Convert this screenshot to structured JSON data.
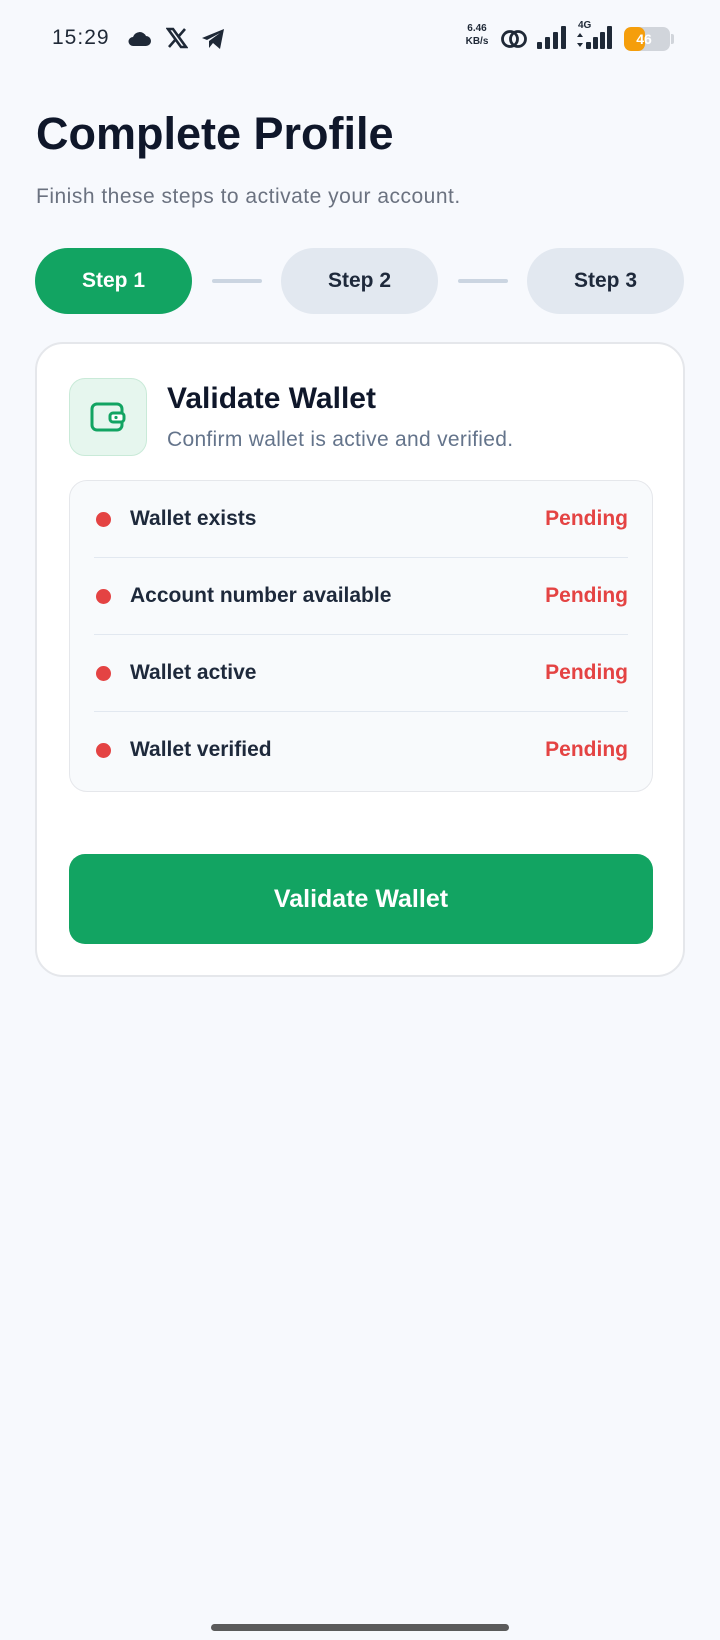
{
  "status_bar": {
    "time": "15:29",
    "net_speed_value": "6.46",
    "net_speed_unit": "KB/s",
    "network_type": "4G",
    "battery_level": "46",
    "icons": [
      "cloud-icon",
      "x-logo-icon",
      "telegram-icon",
      "hotspot-link-icon",
      "signal-icon",
      "signal-4g-icon",
      "battery-icon"
    ]
  },
  "header": {
    "title": "Complete Profile",
    "subtitle": "Finish these steps to activate your account."
  },
  "stepper": {
    "steps": [
      {
        "label": "Step 1",
        "active": true
      },
      {
        "label": "Step 2",
        "active": false
      },
      {
        "label": "Step 3",
        "active": false
      }
    ]
  },
  "card": {
    "icon": "wallet-icon",
    "title": "Validate Wallet",
    "subtitle": "Confirm wallet is active and verified.",
    "checks": [
      {
        "label": "Wallet exists",
        "status": "Pending"
      },
      {
        "label": "Account number available",
        "status": "Pending"
      },
      {
        "label": "Wallet active",
        "status": "Pending"
      },
      {
        "label": "Wallet verified",
        "status": "Pending"
      }
    ],
    "button_label": "Validate Wallet"
  },
  "colors": {
    "accent": "#12a462",
    "pending": "#e44343",
    "battery": "#f59e0b"
  }
}
